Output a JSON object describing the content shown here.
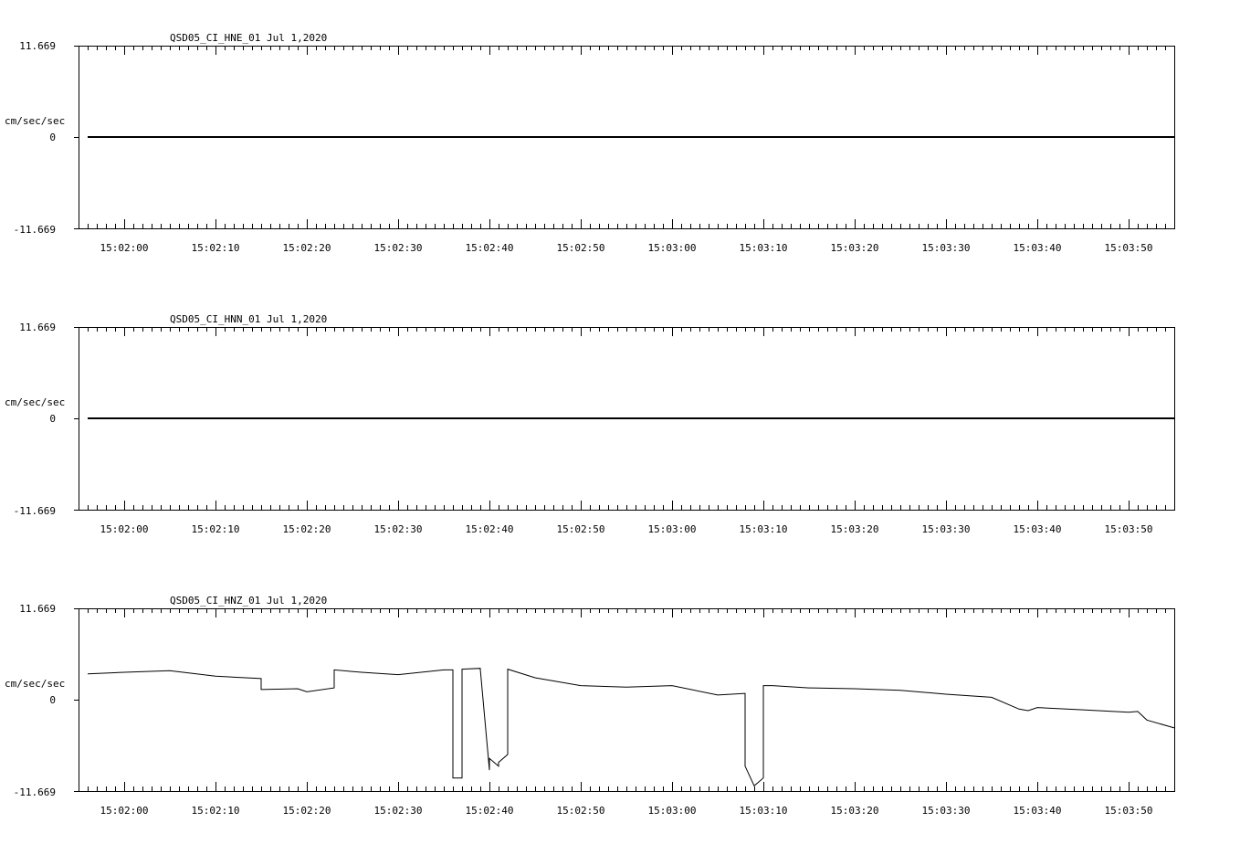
{
  "chart_data": [
    {
      "type": "line",
      "title": "QSD05_CI_HNE_01  Jul 1,2020",
      "ylabel": "cm/sec/sec",
      "ylim": [
        -11.669,
        11.669
      ],
      "ytick_labels": [
        "11.669",
        "0",
        "-11.669"
      ],
      "xlim": [
        "15:01:55",
        "15:03:55"
      ],
      "xtick_labels": [
        "15:02:00",
        "15:02:10",
        "15:02:20",
        "15:02:30",
        "15:02:40",
        "15:02:50",
        "15:03:00",
        "15:03:10",
        "15:03:20",
        "15:03:30",
        "15:03:40",
        "15:03:50"
      ],
      "series": [
        {
          "x": [
            "15:01:56",
            "15:03:55"
          ],
          "y": [
            0,
            0
          ]
        }
      ]
    },
    {
      "type": "line",
      "title": "QSD05_CI_HNN_01  Jul 1,2020",
      "ylabel": "cm/sec/sec",
      "ylim": [
        -11.669,
        11.669
      ],
      "ytick_labels": [
        "11.669",
        "0",
        "-11.669"
      ],
      "xlim": [
        "15:01:55",
        "15:03:55"
      ],
      "xtick_labels": [
        "15:02:00",
        "15:02:10",
        "15:02:20",
        "15:02:30",
        "15:02:40",
        "15:02:50",
        "15:03:00",
        "15:03:10",
        "15:03:20",
        "15:03:30",
        "15:03:40",
        "15:03:50"
      ],
      "series": [
        {
          "x": [
            "15:01:56",
            "15:03:55"
          ],
          "y": [
            0,
            0
          ]
        }
      ]
    },
    {
      "type": "line",
      "title": "QSD05_CI_HNZ_01  Jul 1,2020",
      "ylabel": "cm/sec/sec",
      "ylim": [
        -11.669,
        11.669
      ],
      "ytick_labels": [
        "11.669",
        "0",
        "-11.669"
      ],
      "xlim": [
        "15:01:55",
        "15:03:55"
      ],
      "xtick_labels": [
        "15:02:00",
        "15:02:10",
        "15:02:20",
        "15:02:30",
        "15:02:40",
        "15:02:50",
        "15:03:00",
        "15:03:10",
        "15:03:20",
        "15:03:30",
        "15:03:40",
        "15:03:50"
      ],
      "series": [
        {
          "x": [
            "15:01:56",
            "15:02:00",
            "15:02:05",
            "15:02:10",
            "15:02:15",
            "15:02:15",
            "15:02:19",
            "15:02:20",
            "15:02:23",
            "15:02:23",
            "15:02:26",
            "15:02:30",
            "15:02:35",
            "15:02:36",
            "15:02:36",
            "15:02:37",
            "15:02:37",
            "15:02:39",
            "15:02:39",
            "15:02:40",
            "15:02:40",
            "15:02:41",
            "15:02:41",
            "15:02:42",
            "15:02:42",
            "15:02:45",
            "15:02:50",
            "15:02:55",
            "15:03:00",
            "15:03:05",
            "15:03:08",
            "15:03:08",
            "15:03:09",
            "15:03:10",
            "15:03:10",
            "15:03:11",
            "15:03:15",
            "15:03:20",
            "15:03:25",
            "15:03:30",
            "15:03:35",
            "15:03:38",
            "15:03:39",
            "15:03:40",
            "15:03:45",
            "15:03:50",
            "15:03:51",
            "15:03:52",
            "15:03:55"
          ],
          "y": [
            3.3,
            3.5,
            3.7,
            3.0,
            2.7,
            1.3,
            1.4,
            1.0,
            1.5,
            3.8,
            3.5,
            3.2,
            3.8,
            3.8,
            -10.0,
            -10.0,
            3.9,
            4.0,
            3.9,
            -9.0,
            -7.5,
            -8.5,
            -8.0,
            -7.0,
            3.9,
            2.8,
            1.8,
            1.6,
            1.8,
            0.6,
            0.8,
            -8.5,
            -11.0,
            -10.0,
            1.8,
            1.8,
            1.5,
            1.4,
            1.2,
            0.7,
            0.3,
            -1.2,
            -1.4,
            -1.0,
            -1.3,
            -1.6,
            -1.5,
            -2.6,
            -3.6
          ]
        }
      ]
    }
  ]
}
